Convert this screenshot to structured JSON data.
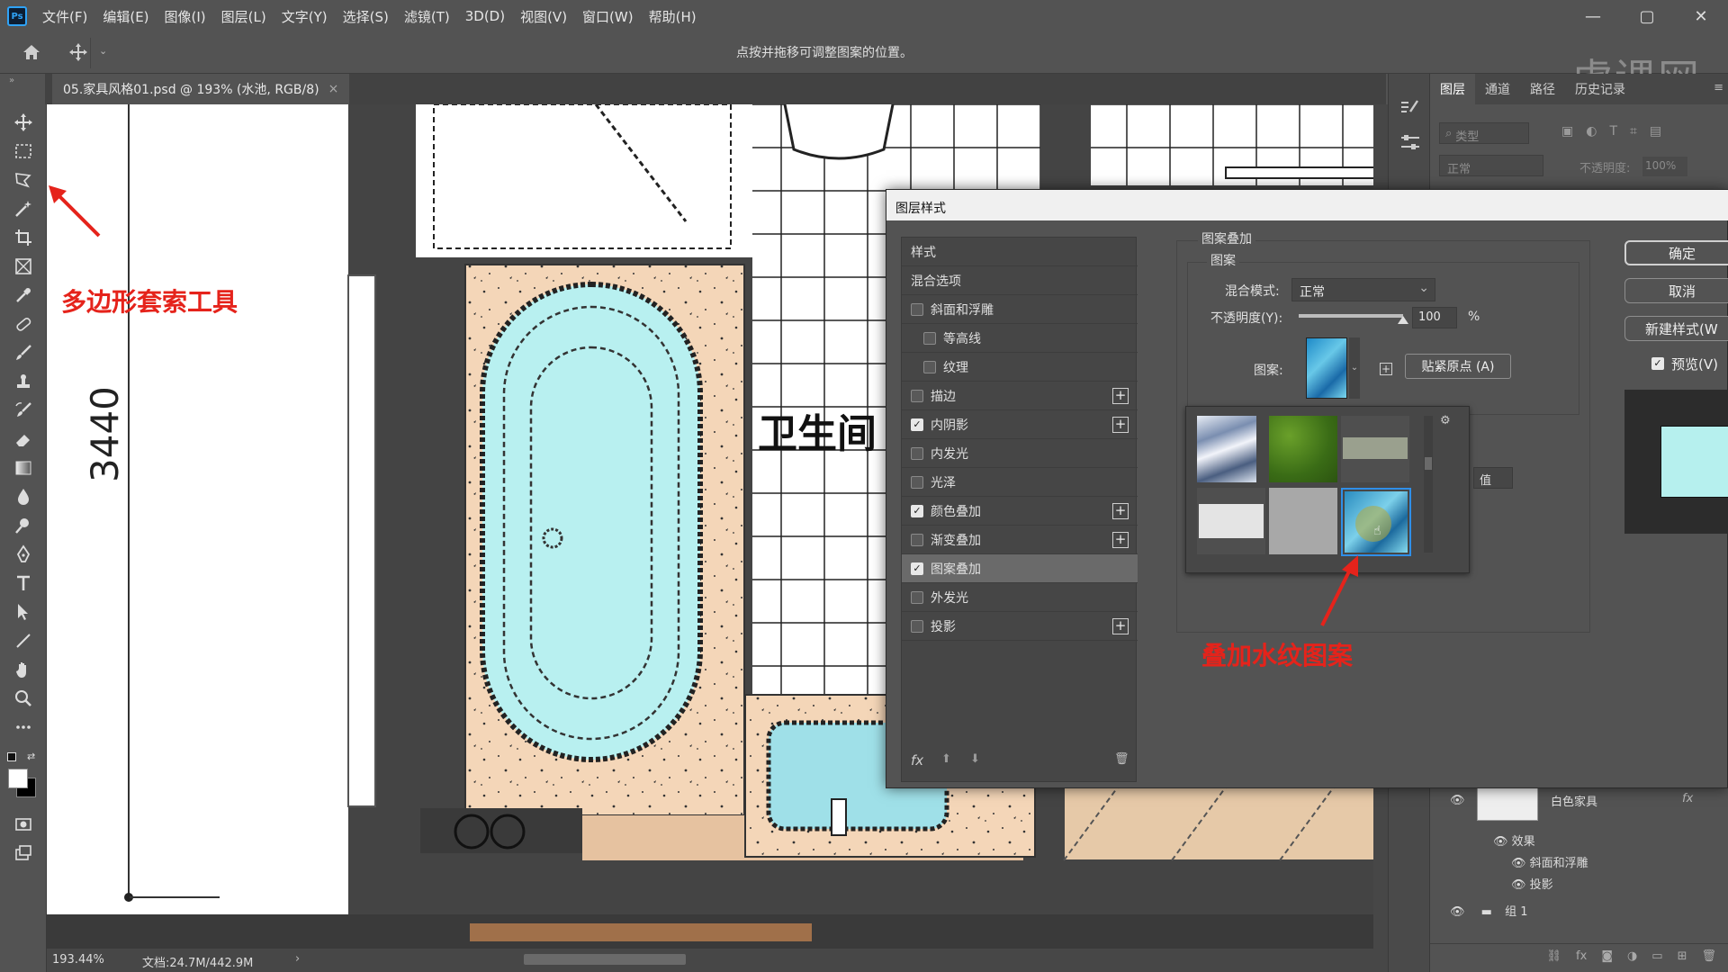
{
  "app": {
    "logo_text": "Ps",
    "menu": [
      "文件(F)",
      "编辑(E)",
      "图像(I)",
      "图层(L)",
      "文字(Y)",
      "选择(S)",
      "滤镜(T)",
      "3D(D)",
      "视图(V)",
      "窗口(W)",
      "帮助(H)"
    ],
    "window_controls": [
      "—",
      "▢",
      "✕"
    ]
  },
  "options_bar": {
    "hint": "点按并拖移可调整图案的位置。",
    "watermark": "虎课网"
  },
  "document": {
    "tab_title": "05.家具风格01.psd @ 193% (水池, RGB/8)",
    "tab_close": "×"
  },
  "canvas": {
    "dimension_label": "3440",
    "room_label": "卫生间",
    "annotation_tool": "多边形套索工具",
    "annotation_pattern": "叠加水纹图案"
  },
  "status": {
    "zoom": "193.44%",
    "doc_info": "文档:24.7M/442.9M",
    "arrow": "›"
  },
  "layers_panel": {
    "tabs": [
      "图层",
      "通道",
      "路径",
      "历史记录"
    ],
    "filter_placeholder": "类型",
    "blend_mode": "正常",
    "opacity_label": "不透明度:",
    "opacity_value": "100%",
    "rows": {
      "white_furniture": "白色家具",
      "effects": "效果",
      "bevel": "斜面和浮雕",
      "shadow": "投影",
      "group": "组 1"
    },
    "fx_label": "fx"
  },
  "dialog": {
    "title": "图层样式",
    "styles": [
      {
        "label": "样式",
        "type": "header"
      },
      {
        "label": "混合选项",
        "type": "header"
      },
      {
        "label": "斜面和浮雕",
        "checked": false,
        "plus": false
      },
      {
        "label": "等高线",
        "checked": false,
        "plus": false,
        "indent": true
      },
      {
        "label": "纹理",
        "checked": false,
        "plus": false,
        "indent": true
      },
      {
        "label": "描边",
        "checked": false,
        "plus": true
      },
      {
        "label": "内阴影",
        "checked": true,
        "plus": true
      },
      {
        "label": "内发光",
        "checked": false,
        "plus": false
      },
      {
        "label": "光泽",
        "checked": false,
        "plus": false
      },
      {
        "label": "颜色叠加",
        "checked": true,
        "plus": true
      },
      {
        "label": "渐变叠加",
        "checked": false,
        "plus": true
      },
      {
        "label": "图案叠加",
        "checked": true,
        "plus": false,
        "selected": true
      },
      {
        "label": "外发光",
        "checked": false,
        "plus": false
      },
      {
        "label": "投影",
        "checked": false,
        "plus": true
      }
    ],
    "section_title": "图案叠加",
    "group_title": "图案",
    "blend_label": "混合模式:",
    "blend_value": "正常",
    "opacity_label": "不透明度(Y):",
    "opacity_value": "100",
    "opacity_unit": "%",
    "opacity_level": 1.0,
    "pattern_label": "图案:",
    "snap_button": "贴紧原点 (A)",
    "hidden_field_fragment": "值",
    "buttons": {
      "ok": "确定",
      "cancel": "取消",
      "new_style": "新建样式(W",
      "preview": "预览(V)"
    },
    "preview_checked": true,
    "fx_text": "fx",
    "preview_color": "#b6f0ee"
  }
}
